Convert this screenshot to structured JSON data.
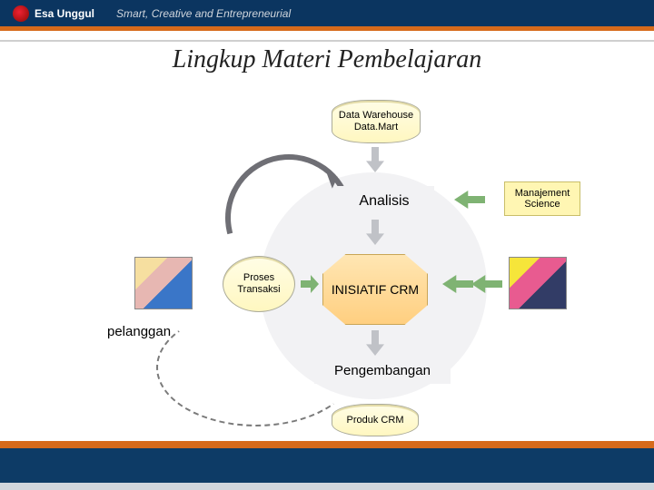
{
  "header": {
    "brand": "Esa Unggul",
    "tagline": "Smart, Creative and Entrepreneurial"
  },
  "title": "Lingkup Materi Pembelajaran",
  "nodes": {
    "data_warehouse": "Data Warehouse Data.Mart",
    "analisis": "Analisis",
    "proses": "Proses Transaksi",
    "initiative": "INISIATIF CRM",
    "pengembangan": "Pengembangan",
    "produk": "Produk CRM",
    "mgmt_science": "Manajement Science",
    "pelanggan": "pelanggan"
  }
}
